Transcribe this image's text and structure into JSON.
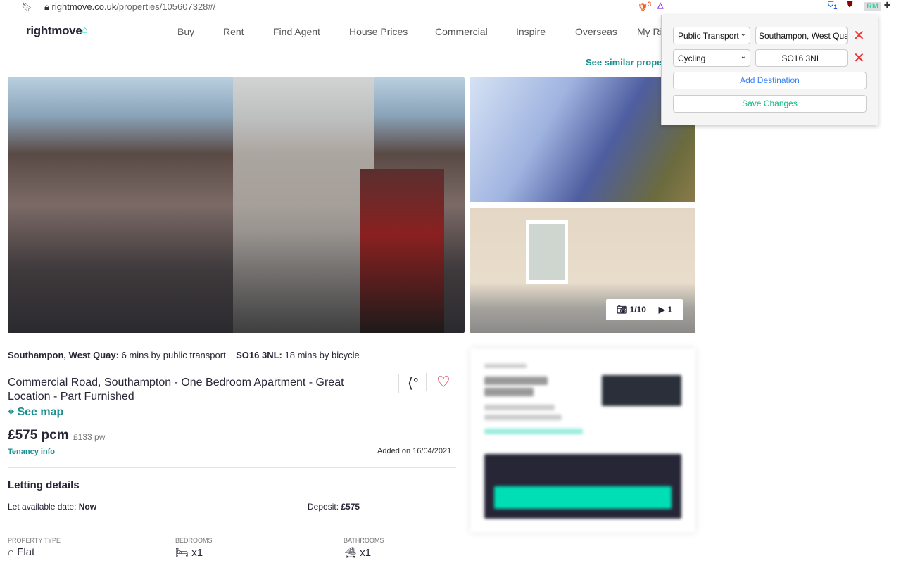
{
  "browser": {
    "url_host": "rightmove.co.uk",
    "url_path": "/properties/105607328#/",
    "extensions": {
      "brave_badge": "3",
      "bitwarden_badge": "1",
      "rm": "RM"
    }
  },
  "nav": {
    "logo": "rightmove",
    "items": [
      "Buy",
      "Rent",
      "Find Agent",
      "House Prices",
      "Commercial",
      "Inspire",
      "Overseas",
      "My Ri"
    ]
  },
  "see_similar": "See similar proper",
  "gallery": {
    "photo_count": "1/10",
    "video_count": "1"
  },
  "travel": [
    {
      "place": "Southampon, West Quay:",
      "time": "6 mins by public transport"
    },
    {
      "place": "SO16 3NL:",
      "time": "18 mins by bicycle"
    }
  ],
  "listing": {
    "title": "Commercial Road, Southampton - One Bedroom Apartment - Great Location - Part Furnished",
    "see_map": "See map",
    "price": "£575 pcm",
    "price_pw": "£133 pw",
    "tenancy": "Tenancy info",
    "added": "Added on 16/04/2021"
  },
  "letting": {
    "heading": "Letting details",
    "available_label": "Let available date:",
    "available": "Now",
    "deposit_label": "Deposit:",
    "deposit": "£575"
  },
  "features": [
    {
      "label": "PROPERTY TYPE",
      "value": "Flat"
    },
    {
      "label": "BEDROOMS",
      "value": "x1"
    },
    {
      "label": "BATHROOMS",
      "value": "x1"
    }
  ],
  "popup": {
    "rows": [
      {
        "mode": "Public Transport",
        "destination": "Southampon, West Qua"
      },
      {
        "mode": "Cycling",
        "destination": "SO16 3NL"
      }
    ],
    "add": "Add Destination",
    "save": "Save Changes",
    "colors": {
      "add": "#3b82f6",
      "save": "#10b981",
      "remove": "#ef4444"
    }
  }
}
